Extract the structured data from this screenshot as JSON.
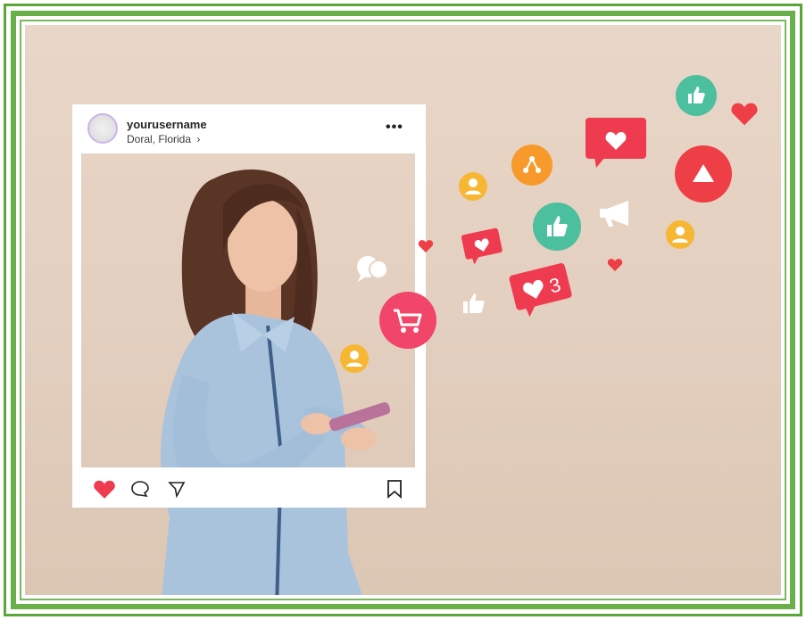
{
  "post": {
    "username": "yourusername",
    "location": "Doral, Florida",
    "location_chevron": "›",
    "more": "•••"
  },
  "colors": {
    "frame_green": "#6ab04a",
    "wall": "#e6d3c4",
    "like_red": "#ef3b4f",
    "teal": "#4bbf9e",
    "orange": "#f79a2b",
    "yellow": "#f7b733"
  },
  "floating_icons": [
    {
      "name": "like-thumb-icon",
      "color": "teal"
    },
    {
      "name": "heart-icon",
      "color": "red"
    },
    {
      "name": "heart-notification-icon",
      "color": "red"
    },
    {
      "name": "share-icon",
      "color": "orange"
    },
    {
      "name": "user-icon",
      "color": "yellow"
    },
    {
      "name": "play-icon",
      "color": "red"
    },
    {
      "name": "megaphone-icon",
      "color": "white"
    },
    {
      "name": "cart-icon",
      "color": "pink"
    },
    {
      "name": "chat-icon",
      "color": "white"
    }
  ],
  "notification": {
    "count": "3"
  }
}
